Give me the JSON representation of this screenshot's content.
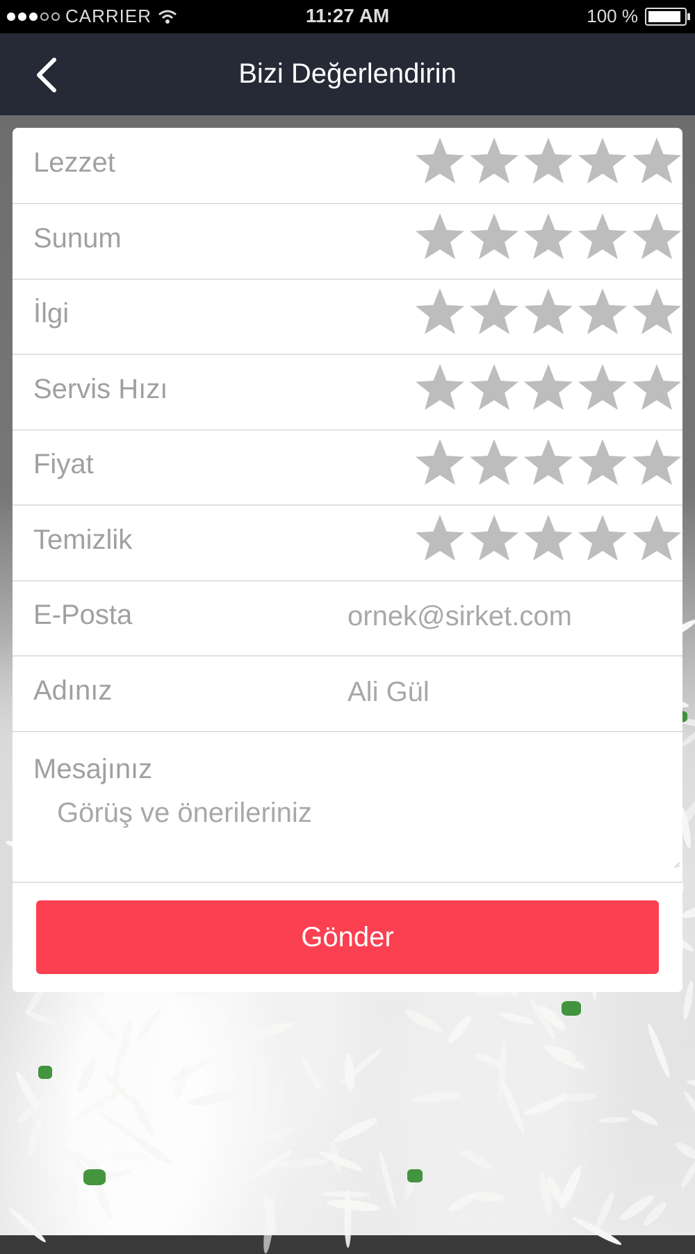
{
  "status_bar": {
    "carrier": "CARRIER",
    "time": "11:27 AM",
    "battery_text": "100 %",
    "battery_level": 1.0,
    "signal_filled": 3,
    "signal_total": 5
  },
  "header": {
    "title": "Bizi Değerlendirin",
    "back_icon": "chevron-left-icon"
  },
  "ratings": [
    {
      "label": "Lezzet",
      "stars": 0,
      "max": 5
    },
    {
      "label": "Sunum",
      "stars": 0,
      "max": 5
    },
    {
      "label": "İlgi",
      "stars": 0,
      "max": 5
    },
    {
      "label": "Servis Hızı",
      "stars": 0,
      "max": 5
    },
    {
      "label": "Fiyat",
      "stars": 0,
      "max": 5
    },
    {
      "label": "Temizlik",
      "stars": 0,
      "max": 5
    }
  ],
  "form": {
    "email": {
      "label": "E-Posta",
      "placeholder": "ornek@sirket.com"
    },
    "name": {
      "label": "Adınız",
      "placeholder": "Ali Gül"
    },
    "message": {
      "label": "Mesajınız",
      "placeholder": "Görüş ve önerileriniz"
    },
    "submit_label": "Gönder"
  },
  "colors": {
    "accent": "#fb4051",
    "navbar": "#262a36",
    "star_empty": "#bdbdbd"
  }
}
